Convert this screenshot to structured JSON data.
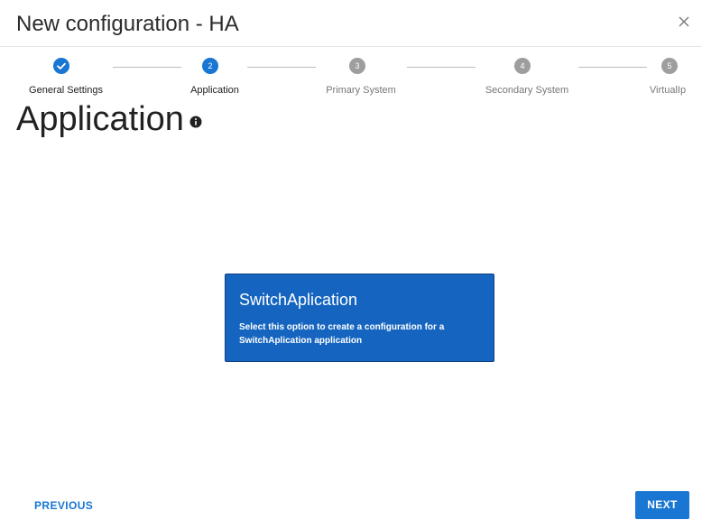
{
  "dialog": {
    "title": "New configuration - HA",
    "close_glyph": "×"
  },
  "stepper": {
    "steps": [
      {
        "number": "1",
        "label": "General Settings",
        "state": "completed",
        "icon": "check-icon"
      },
      {
        "number": "2",
        "label": "Application",
        "state": "active"
      },
      {
        "number": "3",
        "label": "Primary System",
        "state": "pending"
      },
      {
        "number": "4",
        "label": "Secondary System",
        "state": "pending"
      },
      {
        "number": "5",
        "label": "VirtualIp",
        "state": "pending"
      }
    ]
  },
  "section": {
    "title": "Application",
    "info_icon": "info-icon"
  },
  "app_option": {
    "title": "SwitchAplication",
    "description": "Select this option to create a configuration for a SwitchAplication application"
  },
  "footer": {
    "previous_label": "PREVIOUS",
    "next_label": "NEXT"
  },
  "colors": {
    "accent": "#1976d2",
    "card_background": "#1565c0",
    "pending_step": "#9e9e9e"
  }
}
